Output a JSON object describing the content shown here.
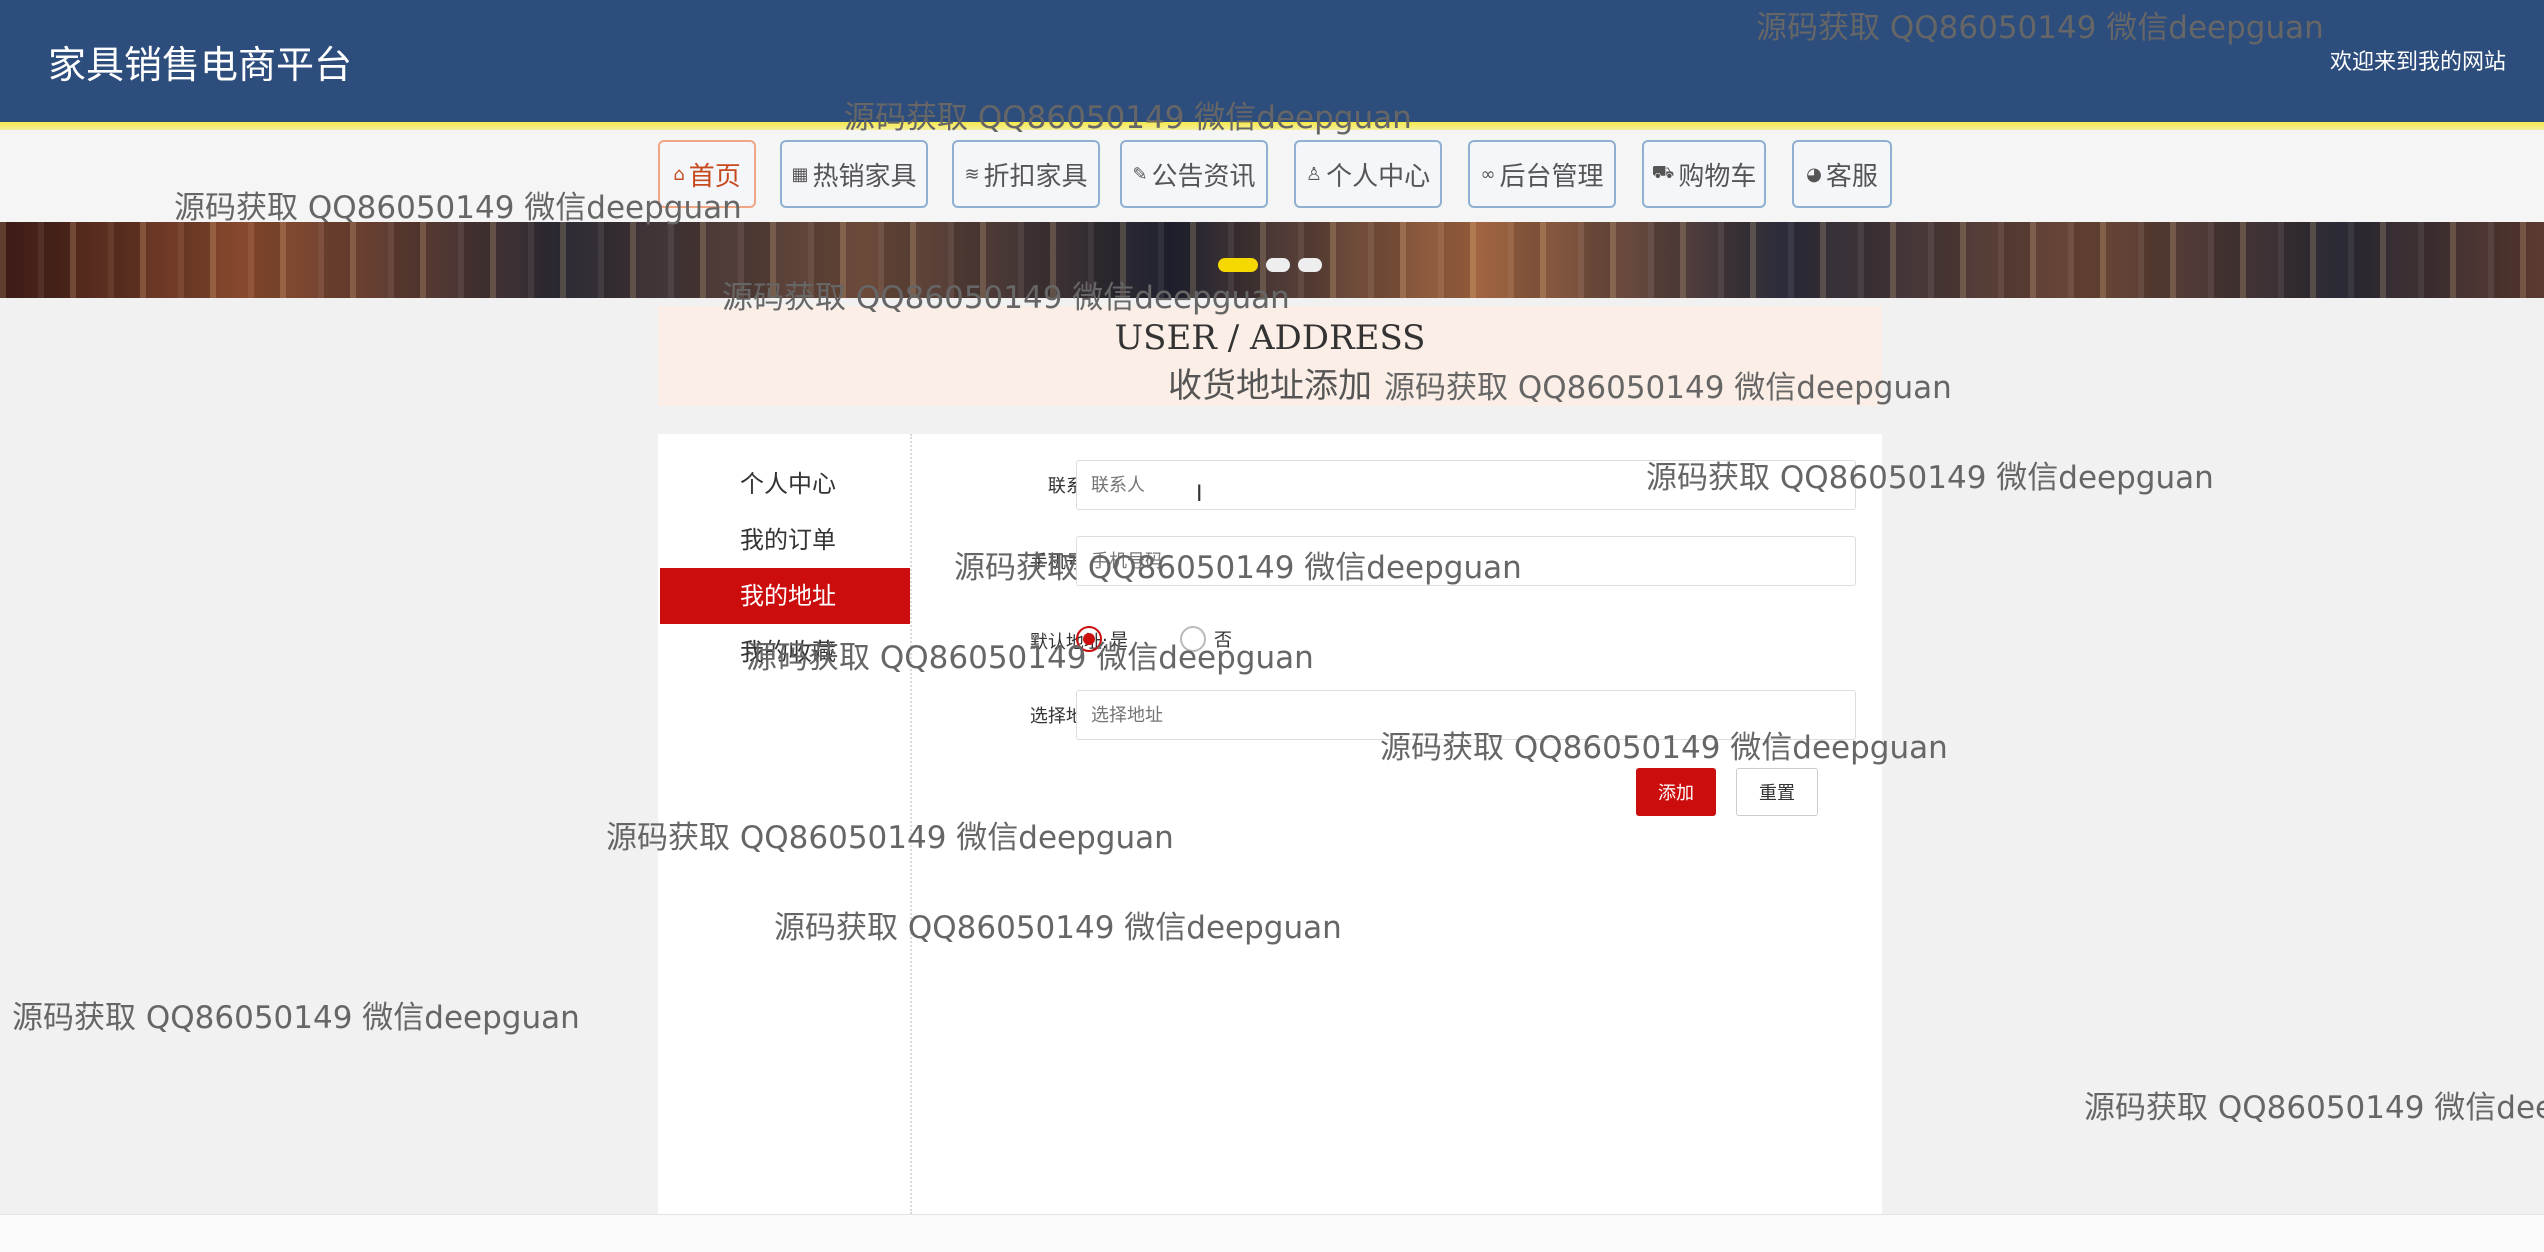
{
  "header": {
    "title": "家具销售电商平台",
    "welcome": "欢迎来到我的网站"
  },
  "nav": [
    {
      "label": "首页",
      "icon": "home-icon",
      "glyph": "⌂"
    },
    {
      "label": "热销家具",
      "icon": "grid-icon",
      "glyph": "▦"
    },
    {
      "label": "折扣家具",
      "icon": "layers-icon",
      "glyph": "≋"
    },
    {
      "label": "公告资讯",
      "icon": "edit-icon",
      "glyph": "✎"
    },
    {
      "label": "个人中心",
      "icon": "user-icon",
      "glyph": "♙"
    },
    {
      "label": "后台管理",
      "icon": "link-icon",
      "glyph": "∞"
    },
    {
      "label": "购物车",
      "icon": "cart-icon",
      "glyph": "⛟"
    },
    {
      "label": "客服",
      "icon": "chat-icon",
      "glyph": "◕"
    }
  ],
  "section": {
    "title_en": "USER / ADDRESS",
    "title_cn": "收货地址添加"
  },
  "sidebar": [
    {
      "label": "个人中心"
    },
    {
      "label": "我的订单"
    },
    {
      "label": "我的地址"
    },
    {
      "label": "我的收藏"
    }
  ],
  "form": {
    "contact_label": "联系人:",
    "contact_placeholder": "联系人",
    "phone_label": "手机号码:",
    "phone_placeholder": "手机号码",
    "default_label": "默认地址:",
    "default_yes": "是",
    "default_no": "否",
    "address_label": "选择地址:",
    "address_placeholder": "选择地址",
    "add_button": "添加",
    "reset_button": "重置"
  },
  "watermark": "源码获取 QQ86050149 微信deepguan",
  "colors": {
    "header": "#2d4d7d",
    "accent": "#cc0d0d",
    "highlight": "#f4d800"
  }
}
